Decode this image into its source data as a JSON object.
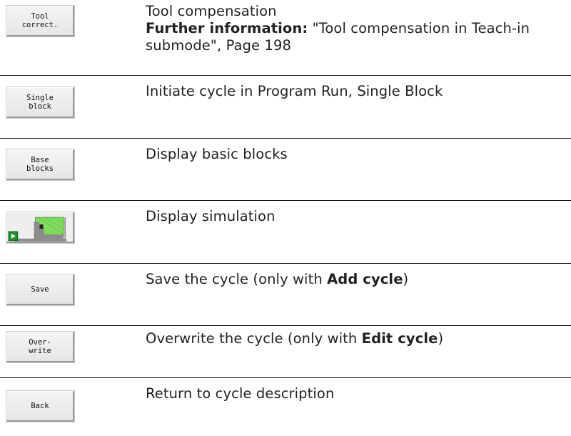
{
  "rows": [
    {
      "key": "Tool\ncorrect.",
      "text": "Tool compensation",
      "info_label": "Further information:",
      "info_text": " \"Tool compensation in Teach-in submode\", Page 198"
    },
    {
      "key": "Single\nblock",
      "text": "Initiate cycle in Program Run, Single Block"
    },
    {
      "key": "Base\nblocks",
      "text": "Display basic blocks"
    },
    {
      "key_icon": "simulation-icon",
      "text": "Display simulation"
    },
    {
      "key": "Save",
      "text_before": "Save the cycle (only with ",
      "text_bold": "Add cycle",
      "text_after": ")"
    },
    {
      "key": "Over-\nwrite",
      "text_before": "Overwrite the cycle (only with ",
      "text_bold": "Edit cycle",
      "text_after": ")"
    },
    {
      "key": "Back",
      "text": "Return to cycle description"
    }
  ],
  "colors": {
    "sim_green": "#7fdc5a",
    "sim_grey": "#8c8c8c",
    "sim_play": "#1f8f2a"
  }
}
